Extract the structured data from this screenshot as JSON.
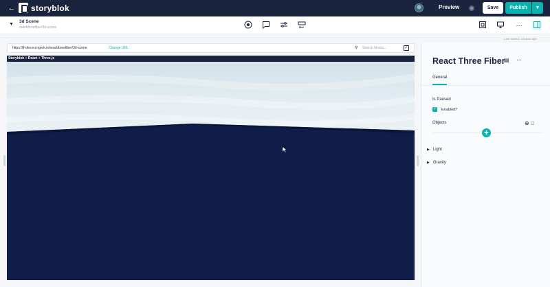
{
  "topbar": {
    "brand": "storyblok",
    "preview_label": "Preview",
    "save_label": "Save",
    "publish_label": "Publish"
  },
  "story": {
    "name": "3d Scene",
    "slug": "reactthreefiber/3d-scene"
  },
  "status": {
    "last_saved": "Last saved: 3 hours ago"
  },
  "urlbar": {
    "url": "https://jf-dev.eu.ngrok.io/reactthreefiber/3d-scene",
    "change_url": "Change URL",
    "search_placeholder": "Search blocks..."
  },
  "preview": {
    "title": "Storyblok + React + Three.js",
    "colors": {
      "sky": "#d6e4ec",
      "ground": "#0f1d48"
    }
  },
  "panel": {
    "title": "React Three Fiber",
    "tabs": [
      {
        "label": "General"
      }
    ],
    "fields": {
      "is_paused_label": "Is Paused",
      "enabled_label": "Enabled?",
      "enabled_checked": true,
      "objects_label": "Objects"
    },
    "sections": [
      {
        "label": "Light"
      },
      {
        "label": "Gravity"
      }
    ]
  },
  "colors": {
    "accent": "#09b3af",
    "navy": "#1b243f"
  }
}
